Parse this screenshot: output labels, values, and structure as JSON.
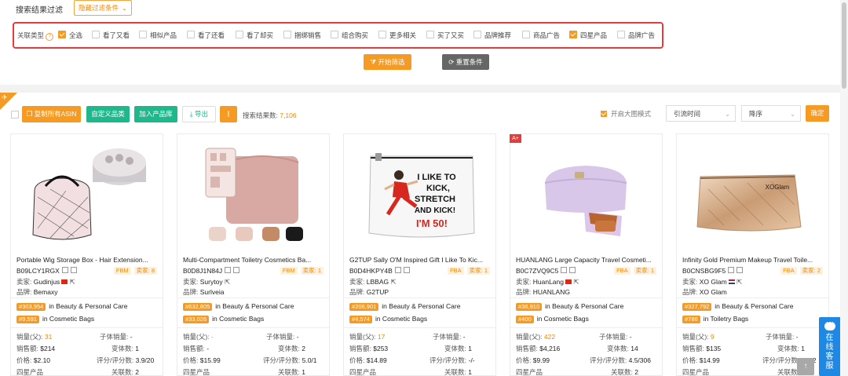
{
  "filter_panel": {
    "title": "搜索结果过滤",
    "hide_filter_label": "隐藏过滤条件",
    "assoc_type_label": "关联类型",
    "assoc_options": [
      {
        "label": "全选",
        "checked": true
      },
      {
        "label": "看了又看",
        "checked": false
      },
      {
        "label": "相似产品",
        "checked": false
      },
      {
        "label": "看了还看",
        "checked": false
      },
      {
        "label": "看了却买",
        "checked": false
      },
      {
        "label": "捆绑销售",
        "checked": false
      },
      {
        "label": "组合购买",
        "checked": false
      },
      {
        "label": "更多相关",
        "checked": false
      },
      {
        "label": "买了又买",
        "checked": false
      },
      {
        "label": "品牌推荐",
        "checked": false
      },
      {
        "label": "商品广告",
        "checked": false
      },
      {
        "label": "四星产品",
        "checked": true
      },
      {
        "label": "品牌广告",
        "checked": false
      }
    ],
    "start_label": "开始筛选",
    "reset_label": "重置条件"
  },
  "toolbar": {
    "copy_asin": "复制所有ASIN",
    "custom_category": "自定义品类",
    "add_to_library": "加入产品库",
    "export": "导出",
    "more": "⋮",
    "result_count_label": "搜索结果数:",
    "result_count": "7,106",
    "big_image_mode": "开启大图模式",
    "sort_field": "引流时间",
    "sort_order": "降序",
    "confirm": "确定"
  },
  "colors": {
    "accent": "#f59a23",
    "green": "#1fb88c",
    "highlight_border": "#e53b3b"
  },
  "products": [
    {
      "name": "Portable Wig Storage Box - Hair Extension...",
      "asin": "B09LCY1RGX",
      "fulfillment": "FBM",
      "seller_count_label": "卖家: 8",
      "seller_label": "卖家:",
      "seller": "Gudinjus",
      "flag": "cn",
      "brand_label": "品牌:",
      "brand": "Bemaxy",
      "rank1": "#303,954",
      "rank1_cat": "in Beauty & Personal Care",
      "rank2": "#9,591",
      "rank2_cat": "in Cosmetic Bags",
      "sales_parent_label": "销量(父):",
      "sales_parent": "31",
      "sales_child_label": "子体销量:",
      "sales_child": "-",
      "revenue_label": "销售额:",
      "revenue": "$214",
      "variants_label": "变体数:",
      "variants": "1",
      "price_label": "价格:",
      "price": "$2.10",
      "rating_label": "评分/评分数:",
      "rating": "3.9/20",
      "assoc_type": "四星产品",
      "assoc_count_label": "关联数:",
      "assoc_count": "2"
    },
    {
      "name": "Multi-Compartment Toiletry Cosmetics Ba...",
      "asin": "B0D8J1N84J",
      "fulfillment": "FBM",
      "seller_count_label": "卖家: 1",
      "seller_label": "卖家:",
      "seller": "Surytoy",
      "flag": "cn",
      "brand_label": "品牌:",
      "brand": "Surlveia",
      "rank1": "#632,805",
      "rank1_cat": "in Beauty & Personal Care",
      "rank2": "#33,026",
      "rank2_cat": "in Cosmetic Bags",
      "sales_parent_label": "销量(父):",
      "sales_parent": "-",
      "sales_child_label": "子体销量:",
      "sales_child": "-",
      "revenue_label": "销售额:",
      "revenue": "-",
      "variants_label": "变体数:",
      "variants": "2",
      "price_label": "价格:",
      "price": "$15.99",
      "rating_label": "评分/评分数:",
      "rating": "5.0/1",
      "assoc_type": "四星产品",
      "assoc_count_label": "关联数:",
      "assoc_count": "1"
    },
    {
      "name": "G2TUP Sally O'M Inspired Gift I Like To Kic...",
      "asin": "B0D4HKPY4B",
      "fulfillment": "FBA",
      "seller_count_label": "卖家: 1",
      "seller_label": "卖家:",
      "seller": "LBBAG",
      "flag": "cn",
      "brand_label": "品牌:",
      "brand": "G2TUP",
      "rank1": "#206,901",
      "rank1_cat": "in Beauty & Personal Care",
      "rank2": "#4,574",
      "rank2_cat": "in Cosmetic Bags",
      "sales_parent_label": "销量(父):",
      "sales_parent": "17",
      "sales_child_label": "子体销量:",
      "sales_child": "-",
      "revenue_label": "销售额:",
      "revenue": "$253",
      "variants_label": "变体数:",
      "variants": "1",
      "price_label": "价格:",
      "price": "$14.89",
      "rating_label": "评分/评分数:",
      "rating": "-/-",
      "assoc_type": "四星产品",
      "assoc_count_label": "关联数:",
      "assoc_count": "1"
    },
    {
      "name": "HUANLANG Large Capacity Travel Cosmeti...",
      "asin": "B0C7ZVQ9C5",
      "fulfillment": "FBA",
      "seller_count_label": "卖家: 1",
      "seller_label": "卖家:",
      "seller": "HuanLang",
      "flag": "cn",
      "brand_label": "品牌:",
      "brand": "HUANLANG",
      "rank1": "#36,910",
      "rank1_cat": "in Beauty & Personal Care",
      "rank2": "#400",
      "rank2_cat": "in Cosmetic Bags",
      "sales_parent_label": "销量(父):",
      "sales_parent": "422",
      "sales_child_label": "子体销量:",
      "sales_child": "-",
      "revenue_label": "销售额:",
      "revenue": "$4,216",
      "variants_label": "变体数:",
      "variants": "14",
      "price_label": "价格:",
      "price": "$9.99",
      "rating_label": "评分/评分数:",
      "rating": "4.5/306",
      "assoc_type": "四星产品",
      "assoc_count_label": "关联数:",
      "assoc_count": "2",
      "badge": "A+"
    },
    {
      "name": "Infinity Gold Premium Makeup Travel Toile...",
      "asin": "B0CNSBG9F5",
      "fulfillment": "FBA",
      "seller_count_label": "卖家: 2",
      "seller_label": "卖家:",
      "seller": "XO Glam",
      "flag": "us",
      "brand_label": "品牌:",
      "brand": "XO Glam",
      "rank1": "#327,792",
      "rank1_cat": "in Beauty & Personal Care",
      "rank2": "#786",
      "rank2_cat": "in Toiletry Bags",
      "sales_parent_label": "销量(父):",
      "sales_parent": "9",
      "sales_child_label": "子体销量:",
      "sales_child": "-",
      "revenue_label": "销售额:",
      "revenue": "$135",
      "variants_label": "变体数:",
      "variants": "1",
      "price_label": "价格:",
      "price": "$14.99",
      "rating_label": "评分/评分数:",
      "rating": "5.0/2",
      "assoc_type": "四星产品",
      "assoc_count_label": "关联数:",
      "assoc_count": "2"
    }
  ],
  "image_text": {
    "kick_line1": "I LIKE TO",
    "kick_line2": "KICK,",
    "kick_line3": "STRETCH",
    "kick_line4": "AND KICK!",
    "kick_line5": "I'M 50!",
    "xo_logo": "XOGlam"
  },
  "chat": {
    "label": "在线客服"
  },
  "back_to_top": "↑"
}
